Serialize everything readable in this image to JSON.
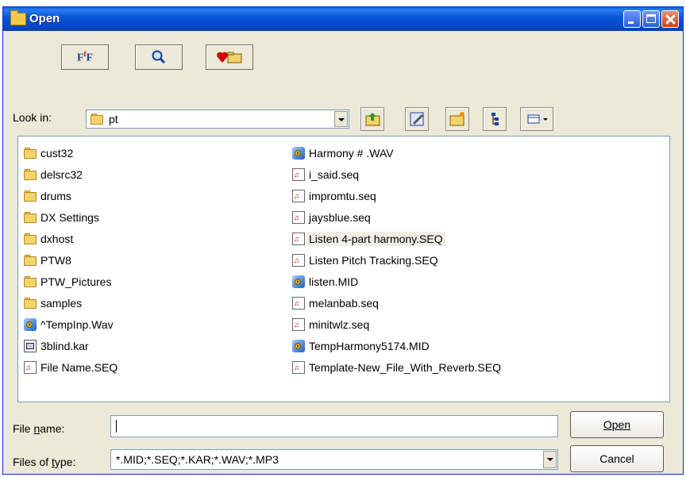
{
  "window": {
    "title": "Open"
  },
  "toolbar": [
    {
      "name": "font-button",
      "glyph": "FⁿF"
    },
    {
      "name": "zoom-button",
      "glyph": "🔍"
    },
    {
      "name": "favorites-button",
      "glyph": "♥"
    }
  ],
  "look_in": {
    "label": "Look in:",
    "value": "pt"
  },
  "files": {
    "left": [
      {
        "name": "cust32",
        "icon": "folder-icon"
      },
      {
        "name": "delsrc32",
        "icon": "folder-icon"
      },
      {
        "name": "drums",
        "icon": "folder-icon"
      },
      {
        "name": "DX Settings",
        "icon": "folder-icon"
      },
      {
        "name": "dxhost",
        "icon": "folder-icon"
      },
      {
        "name": "PTW8",
        "icon": "folder-icon"
      },
      {
        "name": "PTW_Pictures",
        "icon": "folder-icon"
      },
      {
        "name": "samples",
        "icon": "folder-icon"
      },
      {
        "name": "^TempInp.Wav",
        "icon": "media-file-icon"
      },
      {
        "name": "3blind.kar",
        "icon": "kar-file-icon"
      },
      {
        "name": "File Name.SEQ",
        "icon": "seq-file-icon"
      }
    ],
    "right": [
      {
        "name": "Harmony # .WAV",
        "icon": "media-file-icon"
      },
      {
        "name": "i_said.seq",
        "icon": "seq-file-icon"
      },
      {
        "name": "impromtu.seq",
        "icon": "seq-file-icon"
      },
      {
        "name": "jaysblue.seq",
        "icon": "seq-file-icon"
      },
      {
        "name": "Listen 4-part harmony.SEQ",
        "icon": "seq-file-icon",
        "selected": true
      },
      {
        "name": "Listen Pitch Tracking.SEQ",
        "icon": "seq-file-icon"
      },
      {
        "name": "listen.MID",
        "icon": "media-file-icon"
      },
      {
        "name": "melanbab.seq",
        "icon": "seq-file-icon"
      },
      {
        "name": "minitwlz.seq",
        "icon": "seq-file-icon"
      },
      {
        "name": "TempHarmony5174.MID",
        "icon": "media-file-icon"
      },
      {
        "name": "Template-New_File_With_Reverb.SEQ",
        "icon": "seq-file-icon"
      }
    ]
  },
  "file_name": {
    "label": "File name:",
    "value": ""
  },
  "file_type": {
    "label": "Files of type:",
    "value": "*.MID;*.SEQ;*.KAR;*.WAV;*.MP3"
  },
  "buttons": {
    "open": "Open",
    "cancel": "Cancel"
  }
}
